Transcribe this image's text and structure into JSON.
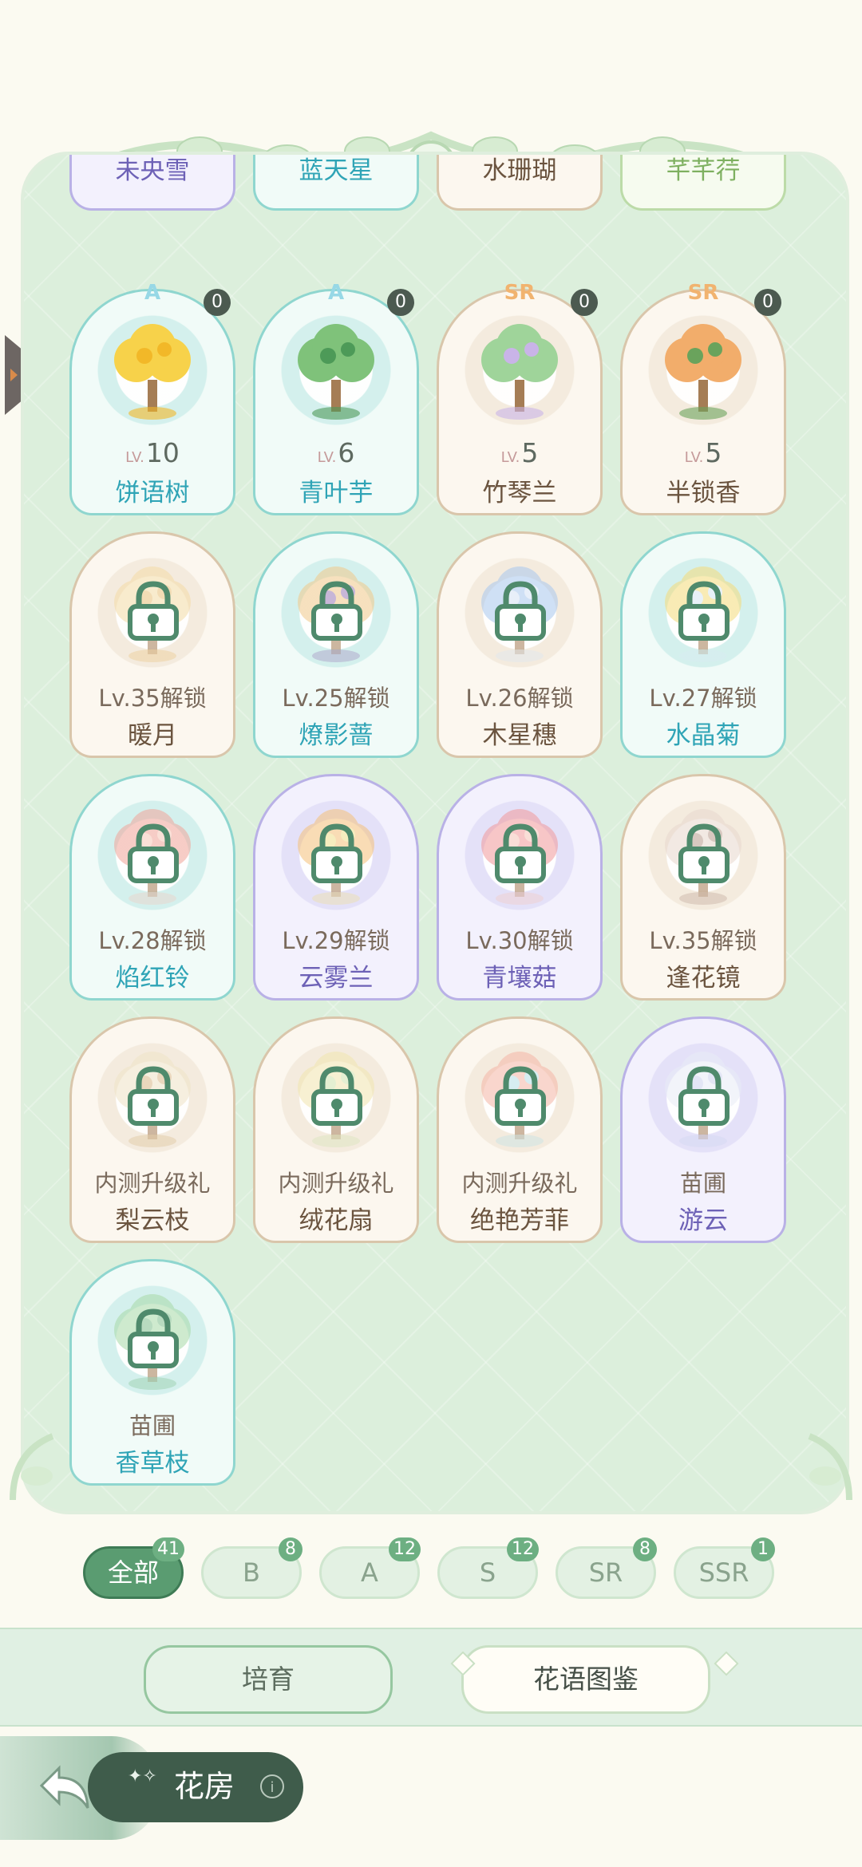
{
  "partial_row": [
    {
      "name": "未央雪",
      "style": "purple"
    },
    {
      "name": "蓝天星",
      "style": "teal"
    },
    {
      "name": "水珊瑚",
      "style": "brown"
    },
    {
      "name": "芊芊荇",
      "style": "green"
    }
  ],
  "cards": [
    {
      "rarity": "A",
      "count": "0",
      "lv_prefix": "LV.",
      "level": "10",
      "name": "饼语树",
      "style": "teal",
      "art": "yellow-tree"
    },
    {
      "rarity": "A",
      "count": "0",
      "lv_prefix": "LV.",
      "level": "6",
      "name": "青叶芋",
      "style": "teal",
      "art": "green-plant"
    },
    {
      "rarity": "SR",
      "count": "0",
      "lv_prefix": "LV.",
      "level": "5",
      "name": "竹琴兰",
      "style": "brown",
      "art": "bamboo"
    },
    {
      "rarity": "SR",
      "count": "0",
      "lv_prefix": "LV.",
      "level": "5",
      "name": "半锁香",
      "style": "brown",
      "art": "orange-roses"
    },
    {
      "unlock": "Lv.35解锁",
      "name": "暖月",
      "style": "brown",
      "art": "moon",
      "locked": true
    },
    {
      "unlock": "Lv.25解锁",
      "name": "燎影蔷",
      "style": "teal",
      "art": "purple-flowers",
      "locked": true
    },
    {
      "unlock": "Lv.26解锁",
      "name": "木星穗",
      "style": "brown",
      "art": "blue-flowers",
      "locked": true
    },
    {
      "unlock": "Lv.27解锁",
      "name": "水晶菊",
      "style": "teal",
      "art": "yellow-chrysanthemum",
      "locked": true
    },
    {
      "unlock": "Lv.28解锁",
      "name": "焰红铃",
      "style": "teal",
      "art": "red-bells",
      "locked": true
    },
    {
      "unlock": "Lv.29解锁",
      "name": "云雾兰",
      "style": "purple",
      "art": "orange-orchid",
      "locked": true
    },
    {
      "unlock": "Lv.30解锁",
      "name": "青壤菇",
      "style": "purple",
      "art": "mushroom",
      "locked": true
    },
    {
      "unlock": "Lv.35解锁",
      "name": "逢花镜",
      "style": "brown",
      "art": "mirror",
      "locked": true
    },
    {
      "unlock": "内测升级礼",
      "name": "梨云枝",
      "style": "brown",
      "art": "pear-branch",
      "locked": true
    },
    {
      "unlock": "内测升级礼",
      "name": "绒花扇",
      "style": "brown",
      "art": "fan",
      "locked": true
    },
    {
      "unlock": "内测升级礼",
      "name": "绝艳芳菲",
      "style": "brown",
      "art": "bouquet",
      "locked": true
    },
    {
      "unlock": "苗圃",
      "name": "游云",
      "style": "purple",
      "art": "cloud-tree",
      "locked": true
    },
    {
      "unlock": "苗圃",
      "name": "香草枝",
      "style": "teal",
      "art": "herb",
      "locked": true
    }
  ],
  "filters": [
    {
      "label": "全部",
      "count": "41",
      "active": true
    },
    {
      "label": "B",
      "count": "8"
    },
    {
      "label": "A",
      "count": "12"
    },
    {
      "label": "S",
      "count": "12"
    },
    {
      "label": "SR",
      "count": "8"
    },
    {
      "label": "SSR",
      "count": "1"
    }
  ],
  "tabs": {
    "cultivate": "培育",
    "catalog": "花语图鉴"
  },
  "home": {
    "label": "花房",
    "info": "i"
  },
  "colors": {
    "panel": "#dcefdc",
    "accent": "#5a9c71",
    "teal": "#2fa4b6",
    "purple": "#6d61b6",
    "brown": "#6b543f"
  },
  "icons": [
    "back-arrow-icon",
    "info-icon",
    "lock-icon",
    "side-tab-arrow-icon"
  ]
}
